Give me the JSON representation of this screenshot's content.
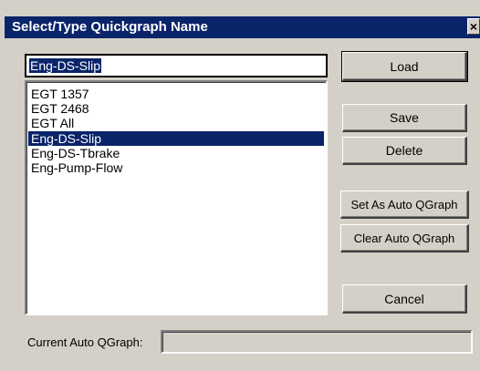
{
  "window": {
    "title": "Select/Type Quickgraph Name",
    "close_label": "×"
  },
  "name_input": {
    "value": "Eng-DS-Slip"
  },
  "list": {
    "items": [
      "EGT 1357",
      "EGT 2468",
      "EGT All",
      "Eng-DS-Slip",
      "Eng-DS-Tbrake",
      "Eng-Pump-Flow"
    ],
    "selected": "Eng-DS-Slip"
  },
  "buttons": {
    "load": "Load",
    "save": "Save",
    "delete": "Delete",
    "set_auto": "Set As Auto QGraph",
    "clear_auto": "Clear Auto QGraph",
    "cancel": "Cancel"
  },
  "footer": {
    "label": "Current Auto QGraph:",
    "value": ""
  }
}
